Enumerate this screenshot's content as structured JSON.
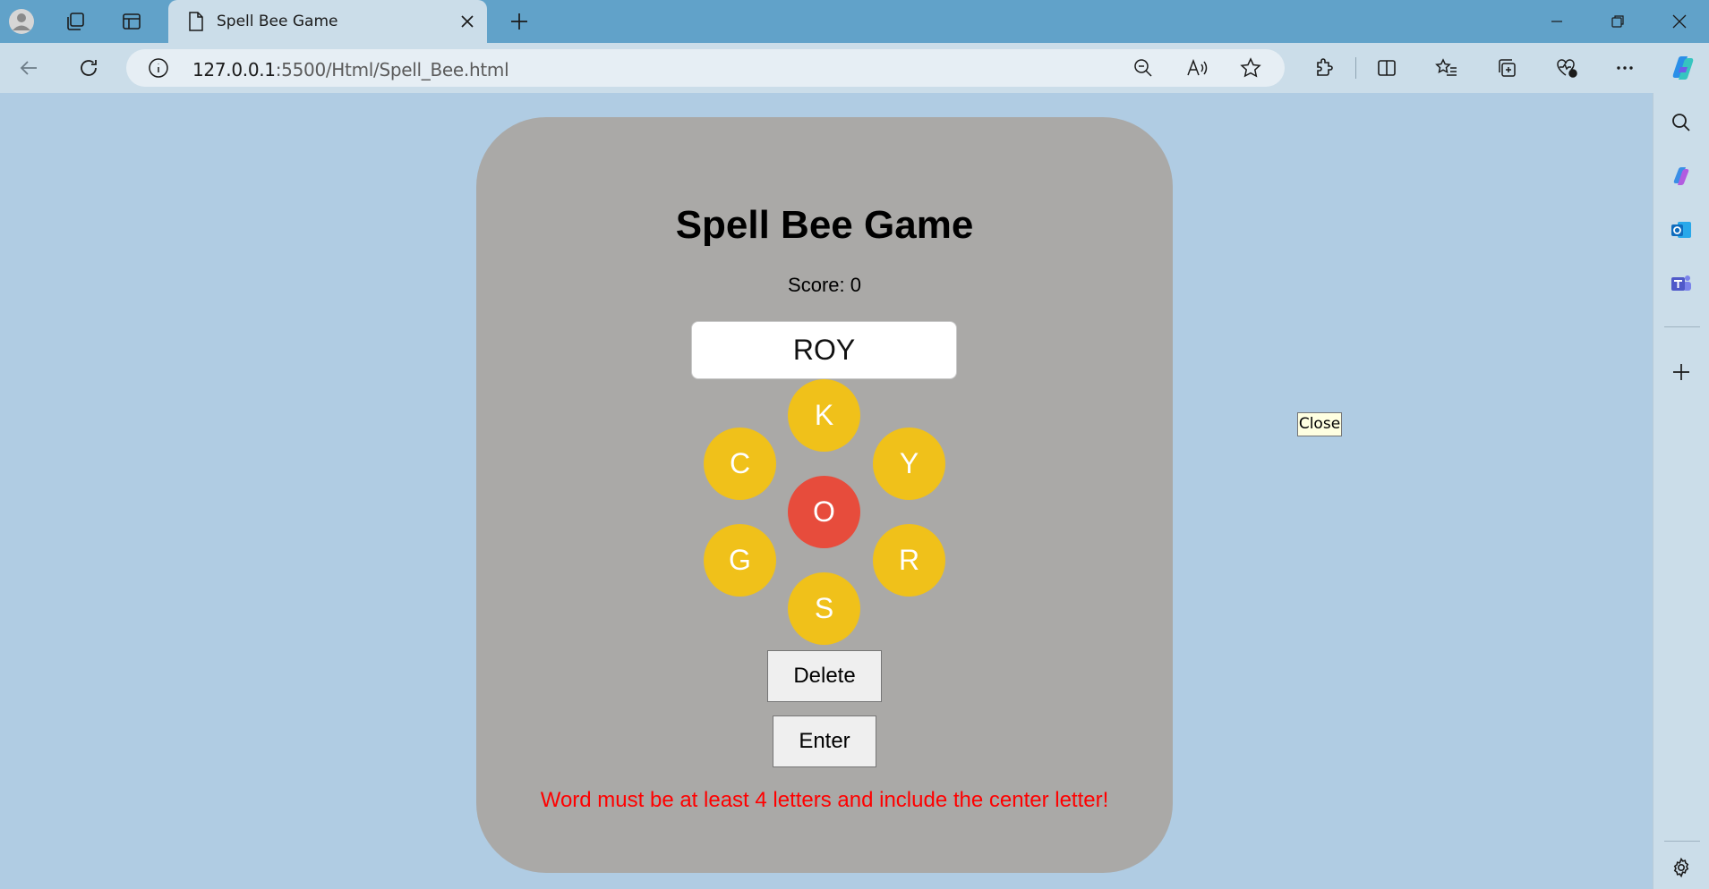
{
  "browser": {
    "tab_title": "Spell Bee Game",
    "url_host": "127.0.0.1",
    "url_rest": ":5500/Html/Spell_Bee.html",
    "tooltip": "Close"
  },
  "game": {
    "title": "Spell Bee Game",
    "score_label": "Score: 0",
    "current_word": "ROY",
    "letters": {
      "top": "K",
      "upper_left": "C",
      "upper_right": "Y",
      "center": "O",
      "lower_left": "G",
      "lower_right": "R",
      "bottom": "S"
    },
    "delete_label": "Delete",
    "enter_label": "Enter",
    "message": "Word must be at least 4 letters and include the center letter!"
  },
  "colors": {
    "page_bg": "#b0cce3",
    "card_bg": "#aaa9a7",
    "letter_cell": "#f0c11a",
    "center_cell": "#e74c3c",
    "error_text": "#ff0000"
  }
}
